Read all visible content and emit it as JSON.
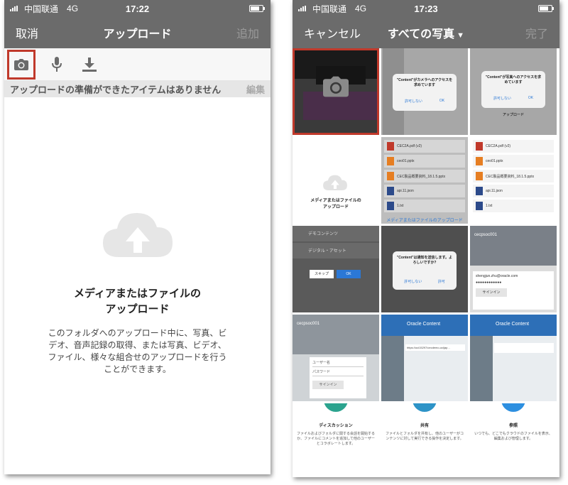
{
  "left": {
    "status": {
      "carrier": "中国联通",
      "network": "4G",
      "time": "17:22"
    },
    "nav": {
      "left": "取消",
      "title": "アップロード",
      "right": "追加"
    },
    "toolbar": {
      "icons": [
        "camera-icon",
        "microphone-icon",
        "download-icon"
      ]
    },
    "subheader": {
      "text": "アップロードの準備ができたアイテムはありません",
      "edit": "編集"
    },
    "empty": {
      "title_line1": "メディアまたはファイルの",
      "title_line2": "アップロード",
      "description": "このフォルダへのアップロード中に、写真、ビデオ、音声記録の取得、または写真、ビデオ、ファイル、様々な組合せのアップロードを行うことができます。"
    }
  },
  "right": {
    "status": {
      "carrier": "中国联通",
      "network": "4G",
      "time": "17:23"
    },
    "nav": {
      "left": "キャンセル",
      "title": "すべての写真",
      "right": "完了"
    },
    "photos": {
      "cam_dialog_title": "\"Content\"がカメラへのアクセスを求めています",
      "photo_dialog_title": "\"Content\"が写真へのアクセスを求めています",
      "deny": "許可しない",
      "ok": "OK",
      "upload_label": "アップロード",
      "files": [
        "CEC2A.pdf (v2)",
        "ceo01.pptx",
        "CEC製品概要資料_18.1.5.pptx",
        "api.11.json",
        "1.txt"
      ],
      "files2": [
        "CEC2A.pdf (v2)",
        "ceo01.pptx",
        "CEC製品概要資料_18.1.5.pptx",
        "api.11.json",
        "1.txt"
      ],
      "media_upload_title": "メディアまたはファイルの",
      "media_upload_title2": "アップロード",
      "media_upload_link": "メディアまたはファイルのアップロード",
      "folder1": "デモコンテンツ",
      "folder2": "デジタル・アセット",
      "skip": "スキップ",
      "notify_title": "\"Content\"は通知を送信します。よろしいですか?",
      "allow": "許可",
      "account": "cecpsoc001",
      "email": "shengjun.zhu@oracle.com",
      "password_mask": "●●●●●●●●●●●●",
      "signin": "サインイン",
      "username_ph": "ユーザー名",
      "password_ph": "パスワード",
      "oracle_content": "Oracle Content",
      "url_text": "https://oci15297/cecdemo-ocijap...",
      "discussion": "ディスカッション",
      "share": "共有",
      "reference": "参照",
      "discussion_desc": "ファイルおよびフォルダに関する会話を開始するか、ファイルにコメントを追加して他のユーザーとコラボレートします。",
      "share_desc": "ファイルとフォルダを共有し、他のユーザーがコンテンツに対して実行できる操作を決定します。",
      "reference_desc": "いつでも、どこでもクラウドのファイルを表示、編集および管理します。"
    }
  }
}
